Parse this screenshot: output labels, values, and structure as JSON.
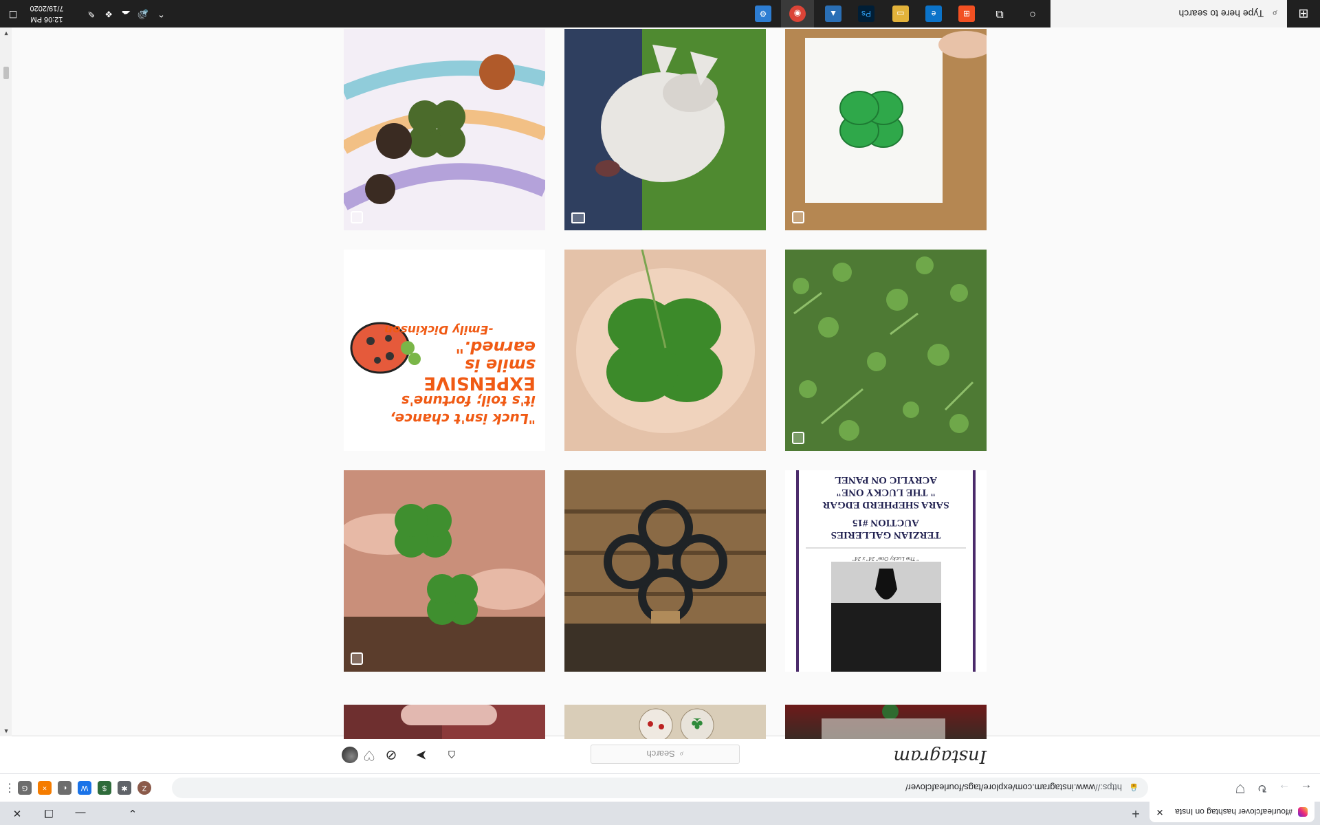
{
  "browser": {
    "tab_title": "#fourleafclover hashtag on Insta",
    "tab_close": "✕",
    "new_tab": "+",
    "url_prefix": "https://",
    "url_main": "www.instagram.com/explore/tags/fourleafclover/",
    "lock_glyph": "🔒",
    "extensions": [
      {
        "name": "profile-avatar",
        "label": "Z",
        "color": "#8b5a4a"
      },
      {
        "name": "puzzle",
        "label": "✱",
        "color": "#5f6368"
      },
      {
        "name": "ext-a",
        "label": "$",
        "color": "#2e6b3a"
      },
      {
        "name": "ext-b",
        "label": "W",
        "color": "#1a73e8"
      },
      {
        "name": "ext-c",
        "label": "◐",
        "color": "#6d6d6d"
      },
      {
        "name": "ext-d",
        "label": "×",
        "color": "#f57c00"
      },
      {
        "name": "ext-e",
        "label": "G",
        "color": "#6d6d6d"
      }
    ]
  },
  "instagram": {
    "logo": "Instagram",
    "search_placeholder": "Search"
  },
  "taskbar": {
    "search_placeholder": "Type here to search",
    "time": "12:06 PM",
    "date": "7/19/2020"
  },
  "posts": [
    {
      "name": "post-painting-clovers",
      "multi": true
    },
    {
      "name": "post-husky-dog",
      "video": true
    },
    {
      "name": "post-clover-drawing",
      "multi": true
    },
    {
      "name": "post-luck-quote-text",
      "multi": false
    },
    {
      "name": "post-clover-on-hand",
      "multi": false
    },
    {
      "name": "post-clover-patch",
      "multi": true
    },
    {
      "name": "post-clovers-in-fingers",
      "multi": true
    },
    {
      "name": "post-horseshoe-clover",
      "multi": false
    },
    {
      "name": "post-auction-flyer",
      "multi": false
    },
    {
      "name": "post-partial-1",
      "multi": false
    },
    {
      "name": "post-partial-2",
      "multi": false
    },
    {
      "name": "post-partial-3",
      "multi": false
    }
  ],
  "quote_post": {
    "line1": "\"Luck isn't chance,",
    "line2": "it's toil; fortune's",
    "line3": "EXPENSIVE",
    "line4": "smile is",
    "line5": "earned.\"",
    "line6": "-Emily Dickinson"
  },
  "auction_post": {
    "line1": "TERZIAN GALLERIES",
    "line2": "AUCTION #15",
    "line3": "SARA SHEPHERD EDGAR",
    "line4": "\" THE LUCKY ONE\"",
    "line5": "ACRYLIC ON PANEL",
    "caption": "\" The Lucky One\" 24\" x 24\""
  }
}
